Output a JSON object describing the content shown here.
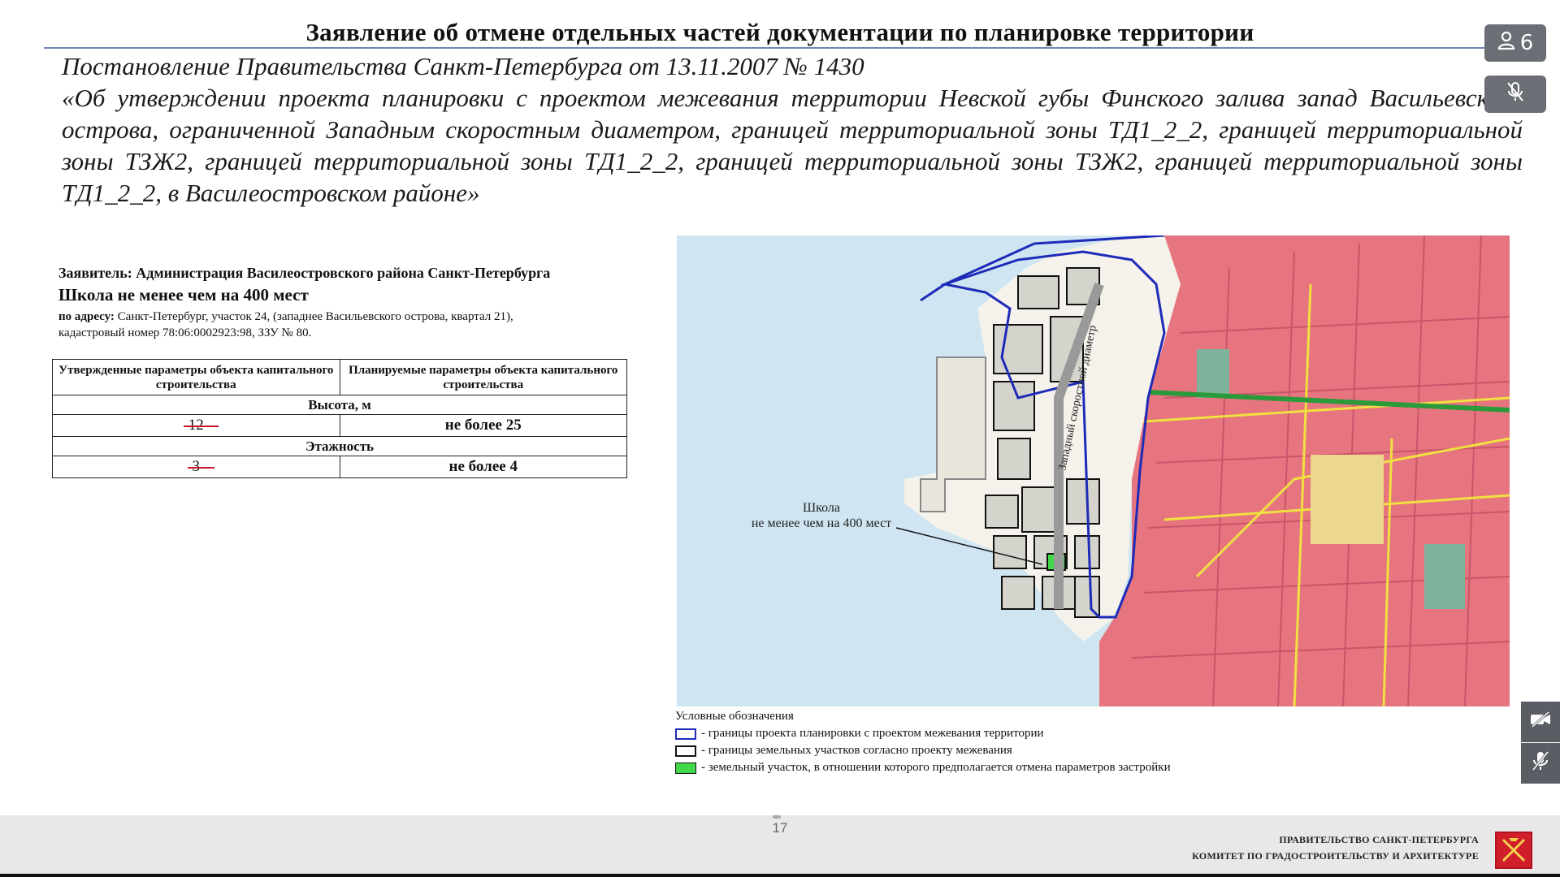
{
  "slide": {
    "title": "Заявление об отмене отдельных частей документации по планировке территории",
    "decree_line1": "Постановление Правительства Санкт-Петербурга от 13.11.2007 № 1430",
    "decree_body": "«Об утверждении проекта планировки с проектом межевания территории Невской губы Финского залива запад Васильевского острова, ограниченной Западным скоростным диаметром, границей территориальной зоны ТД1_2_2, границей территориальной зоны ТЗЖ2, границей территориальной зоны ТД1_2_2, границей территориальной зоны ТЗЖ2, границей территориальной зоны ТД1_2_2, в Василеостровском районе»"
  },
  "applicant": {
    "who": "Заявитель: Администрация Василеостровского района Санкт-Петербурга",
    "object": "Школа не менее чем на 400 мест",
    "address_label": "по адресу:",
    "address_text": "Санкт-Петербург, участок 24, (западнее Васильевского острова, квартал 21),",
    "cadastral": "кадастровый номер 78:06:0002923:98, ЗЗУ № 80."
  },
  "params_table": {
    "col_approved": "Утвержденные параметры объекта капитального строительства",
    "col_planned": "Планируемые параметры объекта капитального строительства",
    "height_label": "Высота, м",
    "height_old": "12",
    "height_new": "не более 25",
    "floors_label": "Этажность",
    "floors_old": "3",
    "floors_new": "не более 4"
  },
  "map": {
    "callout": "Школа",
    "callout2": "не менее чем на 400 мест",
    "road_label": "Западный скоростной диаметр"
  },
  "legend": {
    "heading": "Условные обозначения",
    "item_blue": "- границы проекта планировки с проектом межевания территории",
    "item_black": "- границы земельных участков согласно проекту межевания",
    "item_green": "- земельный участок, в отношении которого предполагается отмена параметров застройки"
  },
  "footer": {
    "page": "17",
    "org1": "ПРАВИТЕЛЬСТВО САНКТ-ПЕТЕРБУРГА",
    "org2": "КОМИТЕТ ПО ГРАДОСТРОИТЕЛЬСТВУ И АРХИТЕКТУРЕ"
  },
  "controls": {
    "participants_count": "6",
    "participants_icon": "person-icon",
    "mute_icon": "microphone-off-icon",
    "side_icons": [
      "video-off-icon",
      "microphone-off-icon"
    ]
  },
  "colors": {
    "title_rule": "#6f86b8",
    "boundary_blue": "#1e2bb8",
    "parcel_green": "#41d84a",
    "district_pink": "#e06a78",
    "water": "#cfe6f2"
  }
}
